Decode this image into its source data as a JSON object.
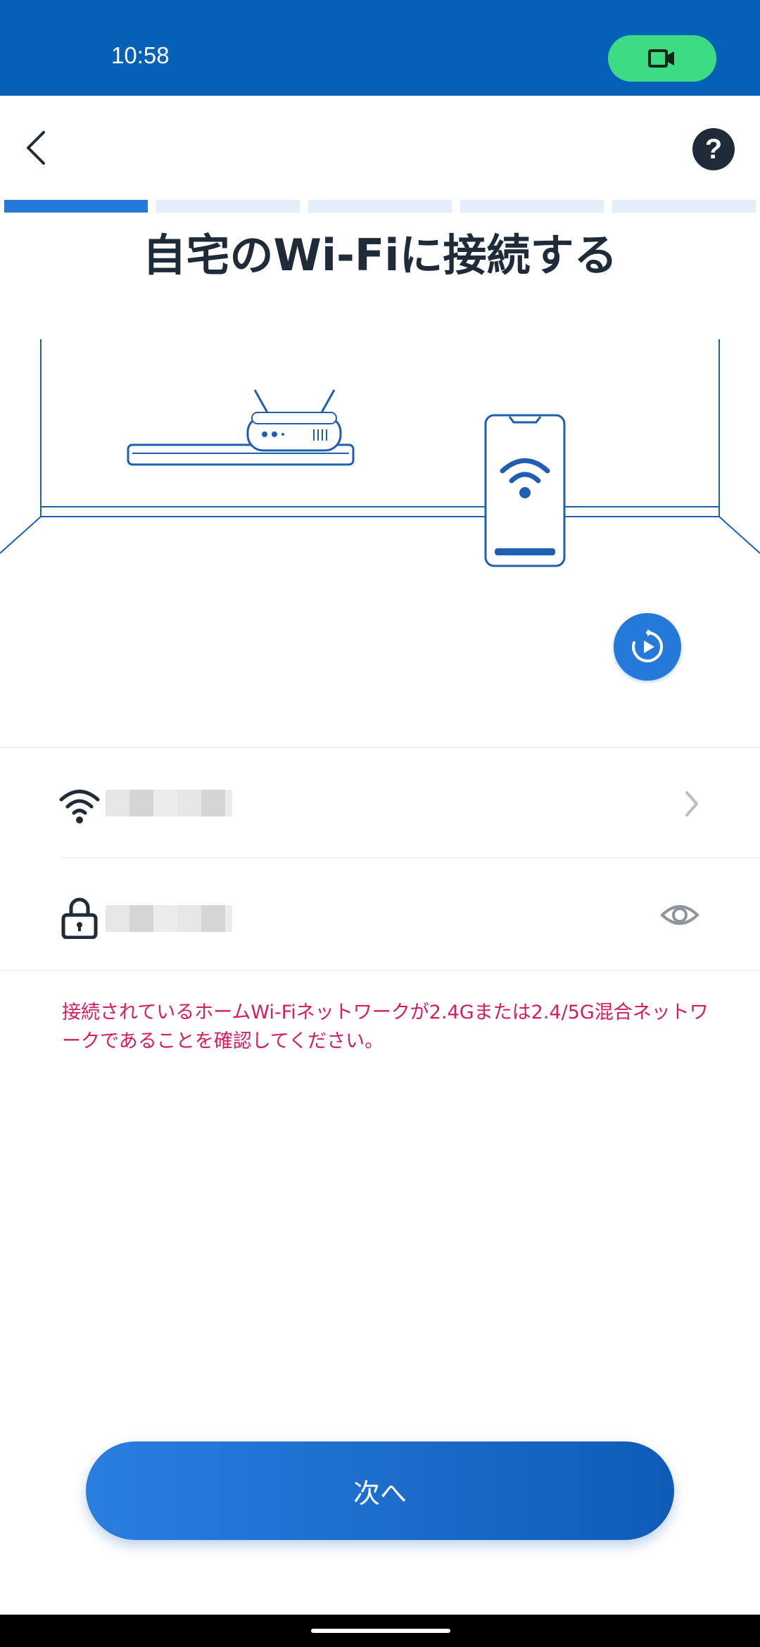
{
  "status_bar": {
    "time": "10:58",
    "call_icon": "video-camera-icon"
  },
  "header": {
    "back_icon": "chevron-left-icon",
    "help_label": "?"
  },
  "progress": {
    "total_steps": 5,
    "current_step": 1
  },
  "page": {
    "title": "自宅のWi-Fiに接続する"
  },
  "illustration": {
    "subject": "router-and-phone-illustration",
    "replay_icon": "replay-icon"
  },
  "network": {
    "ssid_icon": "wifi-icon",
    "ssid_value": "",
    "ssid_action_icon": "chevron-right-icon",
    "password_icon": "lock-icon",
    "password_value": "",
    "password_action_icon": "eye-icon"
  },
  "warning_text": "接続されているホームWi-Fiネットワークが2.4Gまたは2.4/5G混合ネットワークであることを確認してください。",
  "actions": {
    "next_label": "次へ"
  },
  "colors": {
    "status_bar": "#0561b8",
    "accent": "#2479d9",
    "warning": "#d81b60",
    "call_pill": "#3ddc84",
    "title": "#1f2b38"
  }
}
